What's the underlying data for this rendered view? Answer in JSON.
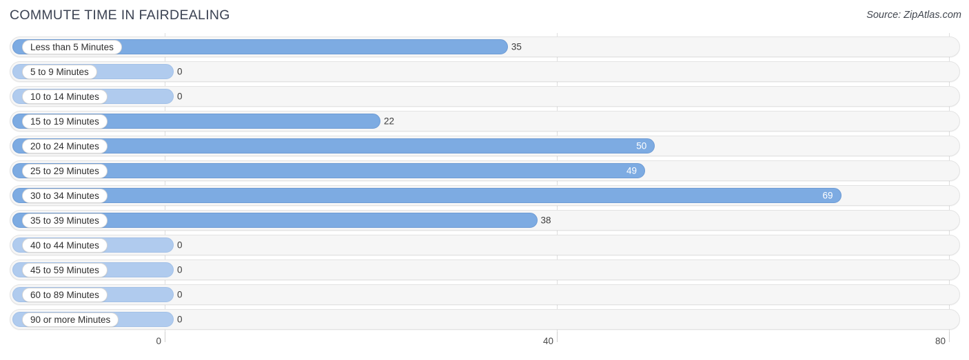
{
  "header": {
    "title": "COMMUTE TIME IN FAIRDEALING",
    "source": "Source: ZipAtlas.com"
  },
  "colors": {
    "bar_filled": "#7dabe2",
    "bar_zero": "#b0cbee",
    "track": "#f6f6f6",
    "gridline": "#d8d8d8",
    "title_text": "#3b4252"
  },
  "chart_data": {
    "type": "bar",
    "orientation": "horizontal",
    "title": "COMMUTE TIME IN FAIRDEALING",
    "xlabel": "",
    "ylabel": "",
    "xlim": [
      0,
      80
    ],
    "ticks": [
      "0",
      "40",
      "80"
    ],
    "tick_values": [
      0,
      40,
      80
    ],
    "grid": true,
    "legend": null,
    "categories": [
      "Less than 5 Minutes",
      "5 to 9 Minutes",
      "10 to 14 Minutes",
      "15 to 19 Minutes",
      "20 to 24 Minutes",
      "25 to 29 Minutes",
      "30 to 34 Minutes",
      "35 to 39 Minutes",
      "40 to 44 Minutes",
      "45 to 59 Minutes",
      "60 to 89 Minutes",
      "90 or more Minutes"
    ],
    "values": [
      35,
      0,
      0,
      22,
      50,
      49,
      69,
      38,
      0,
      0,
      0,
      0
    ],
    "value_labels": [
      "35",
      "0",
      "0",
      "22",
      "50",
      "49",
      "69",
      "38",
      "0",
      "0",
      "0",
      "0"
    ]
  }
}
